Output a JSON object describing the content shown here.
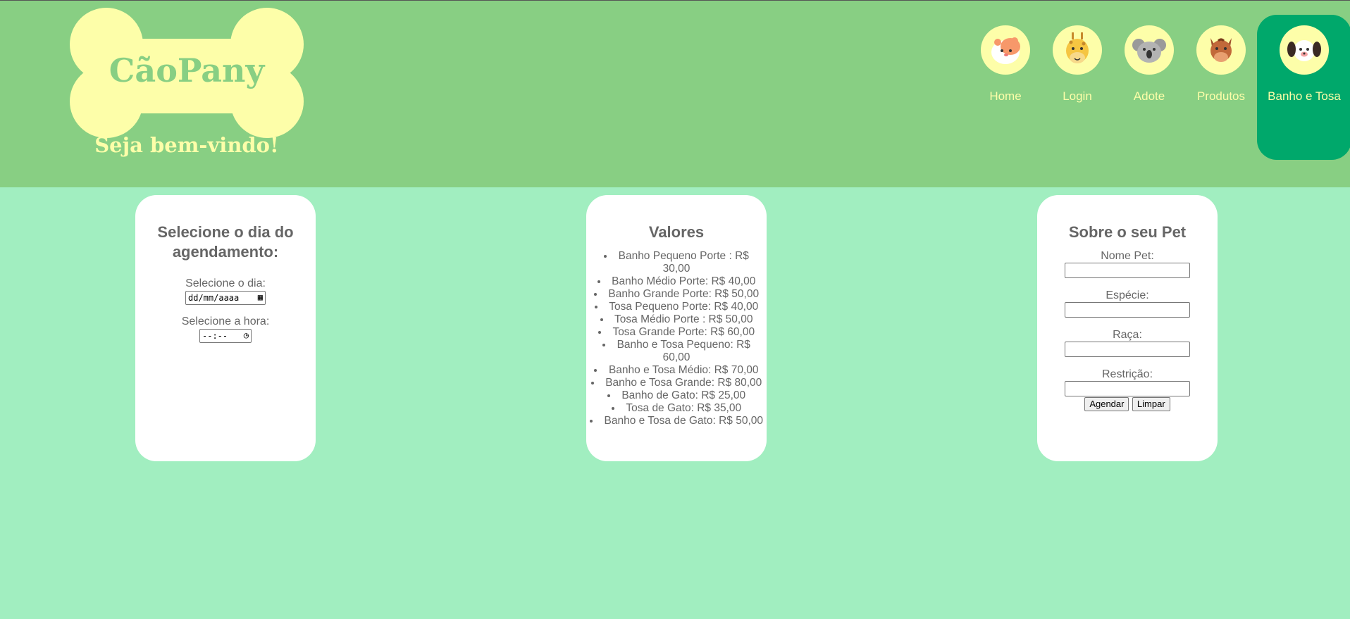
{
  "brand": {
    "name": "CãoPany",
    "welcome": "Seja bem-vindo!",
    "colors": {
      "header": "#88cf83",
      "background": "#a1eec0",
      "accent": "#fdfea9",
      "active": "#00a86b"
    }
  },
  "nav": {
    "items": [
      {
        "label": "Home",
        "icon": "hamster-icon",
        "active": false
      },
      {
        "label": "Login",
        "icon": "giraffe-icon",
        "active": false
      },
      {
        "label": "Adote",
        "icon": "koala-icon",
        "active": false
      },
      {
        "label": "Produtos",
        "icon": "horse-icon",
        "active": false
      },
      {
        "label": "Banho e Tosa",
        "icon": "dog-icon",
        "active": true
      }
    ]
  },
  "schedule": {
    "title": "Selecione o dia do agendamento:",
    "day_label": "Selecione o dia:",
    "day_placeholder": "dd/mm/aaaa",
    "time_label": "Selecione a hora:",
    "time_placeholder": "--:--"
  },
  "prices": {
    "title": "Valores",
    "items": [
      "Banho Pequeno Porte : R$ 30,00",
      "Banho Médio Porte: R$ 40,00",
      "Banho Grande Porte: R$ 50,00",
      "Tosa Pequeno Porte: R$ 40,00",
      "Tosa Médio Porte : R$ 50,00",
      "Tosa Grande Porte: R$ 60,00",
      "Banho e Tosa Pequeno: R$ 60,00",
      "Banho e Tosa Médio: R$ 70,00",
      "Banho e Tosa Grande: R$ 80,00",
      "Banho de Gato: R$ 25,00",
      "Tosa de Gato: R$ 35,00",
      "Banho e Tosa de Gato: R$ 50,00"
    ]
  },
  "pet": {
    "title": "Sobre o seu Pet",
    "fields": [
      "Nome Pet:",
      "Espécie:",
      "Raça:",
      "Restrição:"
    ],
    "submit_label": "Agendar",
    "reset_label": "Limpar"
  }
}
